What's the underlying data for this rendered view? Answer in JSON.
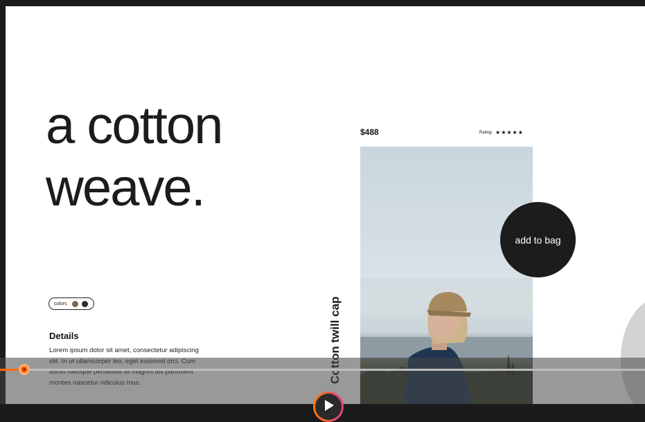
{
  "hero": {
    "line1": "a cotton",
    "line2": "weave."
  },
  "colors": {
    "label": "colors",
    "swatches": [
      "#7b6654",
      "#2a2a2a"
    ]
  },
  "details": {
    "title": "Details",
    "body": "Lorem ipsum dolor sit amet, consectetur adipiscing elit. In ut ullamcorper leo, eget euismod orci. Cum sociis natoque penatibus et magnis dis parturient montes nascetur ridiculus mus."
  },
  "product": {
    "name": "Cotton twill cap",
    "price": "$488",
    "rating_label": "Rating:",
    "rating_stars": "★★★★★",
    "rating_value": 5,
    "rating_max": 5,
    "add_to_bag": "add to bag"
  },
  "player": {
    "progress_fraction": 0.038,
    "accent": "#ff6a00",
    "play_icon": "play-icon"
  }
}
